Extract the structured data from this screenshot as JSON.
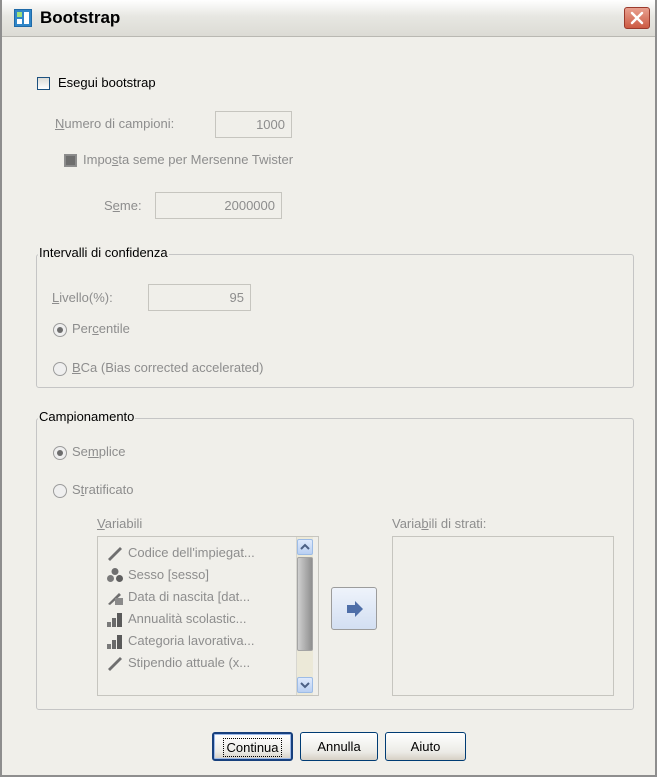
{
  "window": {
    "title": "Bootstrap"
  },
  "perform_bootstrap": {
    "label_pre": "Ese",
    "label_acc": "g",
    "label_post": "ui bootstrap",
    "checked": false
  },
  "num_samples": {
    "label_acc": "N",
    "label_post": "umero di campioni:",
    "value": "1000"
  },
  "set_seed": {
    "label_pre": "Impo",
    "label_acc": "s",
    "label_post": "ta seme per Mersenne Twister"
  },
  "seed": {
    "label_pre": "S",
    "label_acc": "e",
    "label_post": "me:",
    "value": "2000000"
  },
  "confidence": {
    "title": "Intervalli di confidenza",
    "level": {
      "label_acc": "L",
      "label_post": "ivello(%):",
      "value": "95"
    },
    "percentile": {
      "label_pre": "Per",
      "label_acc": "c",
      "label_post": "entile",
      "selected": true
    },
    "bca": {
      "label_acc": "B",
      "label_post": "Ca (Bias corrected accelerated)",
      "selected": false
    }
  },
  "sampling": {
    "title": "Campionamento",
    "simple": {
      "label_pre": "Se",
      "label_acc": "m",
      "label_post": "plice",
      "selected": true
    },
    "stratified": {
      "label_pre": "S",
      "label_acc": "t",
      "label_post": "ratificato",
      "selected": false
    },
    "variables_label": {
      "label_acc": "V",
      "label_post": "ariabili"
    },
    "strata_label": {
      "label_pre": "Varia",
      "label_acc": "b",
      "label_post": "ili di strati:"
    },
    "variables": [
      {
        "label": "Codice dell'impiegat...",
        "icon": "scale-icon"
      },
      {
        "label": "Sesso [sesso]",
        "icon": "nominal-icon"
      },
      {
        "label": "Data di nascita [dat...",
        "icon": "date-scale-icon"
      },
      {
        "label": "Annualità scolastic...",
        "icon": "ordinal-icon"
      },
      {
        "label": "Categoria lavorativa...",
        "icon": "ordinal-icon"
      },
      {
        "label": "Stipendio attuale (x...",
        "icon": "scale-icon"
      }
    ],
    "strata_variables": []
  },
  "buttons": {
    "continue": "Continua",
    "cancel": "Annulla",
    "help": "Aiuto"
  },
  "colors": {
    "disabled_text": "#8d8d8d",
    "dialog_bg": "#f0efea",
    "close_red": "#cc5a43"
  }
}
